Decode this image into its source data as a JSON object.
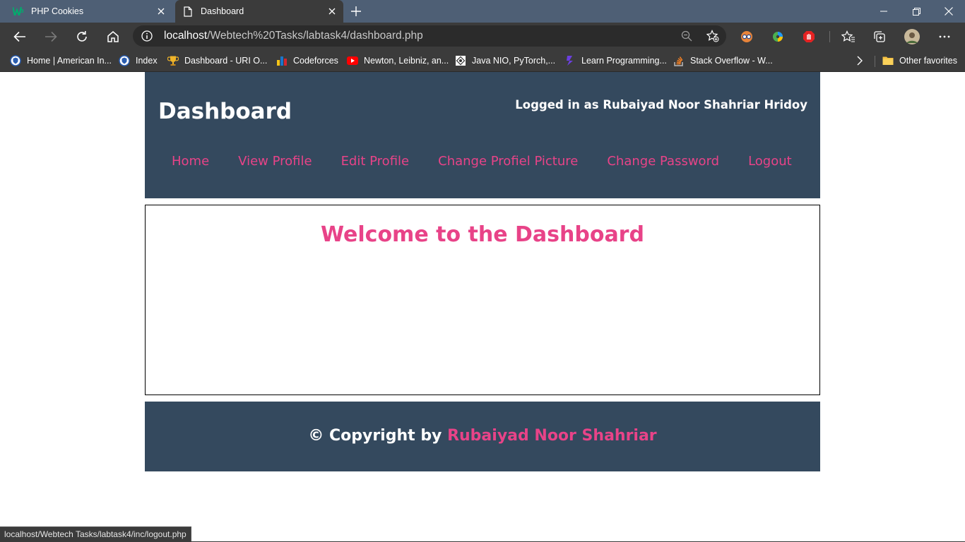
{
  "browser": {
    "tabs": [
      {
        "title": "PHP Cookies",
        "icon": "w3schools-icon",
        "active": false
      },
      {
        "title": "Dashboard",
        "icon": "page-icon",
        "active": true
      }
    ],
    "address": {
      "host": "localhost",
      "path": "/Webtech%20Tasks/labtask4/dashboard.php"
    },
    "bookmarks": [
      {
        "label": "Home | American In...",
        "icon": "shield-icon"
      },
      {
        "label": "Index",
        "icon": "shield-icon"
      },
      {
        "label": "Dashboard - URI O...",
        "icon": "trophy-icon"
      },
      {
        "label": "Codeforces",
        "icon": "bar-chart-icon"
      },
      {
        "label": "Newton, Leibniz, an...",
        "icon": "youtube-icon"
      },
      {
        "label": "Java NIO, PyTorch,...",
        "icon": "puzzle-icon"
      },
      {
        "label": "Learn Programming...",
        "icon": "code-icon"
      },
      {
        "label": "Stack Overflow - W...",
        "icon": "stackoverflow-icon"
      }
    ],
    "other_favorites": "Other favorites",
    "status_url": "localhost/Webtech Tasks/labtask4/inc/logout.php"
  },
  "header": {
    "title": "Dashboard",
    "logged_in_text": "Logged in as Rubaiyad Noor Shahriar Hridoy"
  },
  "nav": {
    "items": [
      "Home",
      "View Profile",
      "Edit Profile",
      "Change Profiel Picture",
      "Change Password",
      "Logout"
    ]
  },
  "main": {
    "welcome": "Welcome to the Dashboard"
  },
  "footer": {
    "copyright_prefix": "© Copyright by",
    "author": "Rubaiyad Noor Shahriar"
  },
  "colors": {
    "header_bg": "#34495e",
    "accent_pink": "#e84388",
    "chrome_dark": "#3b3b3b",
    "titlebar": "#4e5f75"
  }
}
